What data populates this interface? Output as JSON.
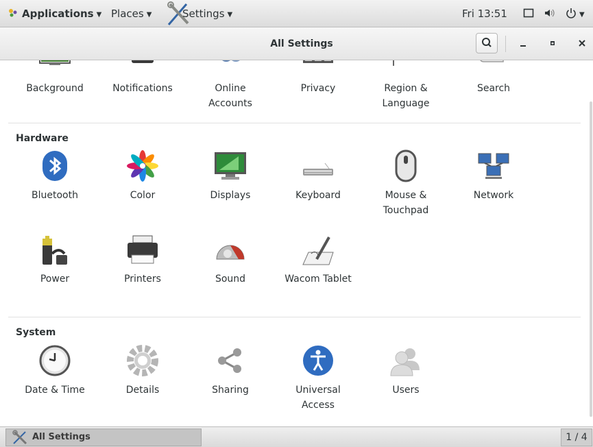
{
  "top_panel": {
    "applications": "Applications",
    "places": "Places",
    "settings": "Settings",
    "clock": "Fri 13:51"
  },
  "window": {
    "title": "All Settings",
    "search_icon": "search-icon",
    "minimize_icon": "minimize-icon",
    "maximize_icon": "maximize-icon",
    "close_icon": "close-icon"
  },
  "personal": {
    "items": [
      {
        "label": "Background",
        "icon": "background-icon"
      },
      {
        "label": "Notifications",
        "icon": "notifications-icon"
      },
      {
        "label": "Online\nAccounts",
        "icon": "online-accounts-icon"
      },
      {
        "label": "Privacy",
        "icon": "privacy-icon"
      },
      {
        "label": "Region &\nLanguage",
        "icon": "region-icon"
      },
      {
        "label": "Search",
        "icon": "search-settings-icon"
      }
    ]
  },
  "hardware": {
    "title": "Hardware",
    "items": [
      {
        "label": "Bluetooth",
        "icon": "bluetooth-icon"
      },
      {
        "label": "Color",
        "icon": "color-icon"
      },
      {
        "label": "Displays",
        "icon": "displays-icon"
      },
      {
        "label": "Keyboard",
        "icon": "keyboard-icon"
      },
      {
        "label": "Mouse &\nTouchpad",
        "icon": "mouse-icon"
      },
      {
        "label": "Network",
        "icon": "network-icon"
      },
      {
        "label": "Power",
        "icon": "power-icon"
      },
      {
        "label": "Printers",
        "icon": "printer-icon"
      },
      {
        "label": "Sound",
        "icon": "sound-icon"
      },
      {
        "label": "Wacom Tablet",
        "icon": "tablet-icon"
      }
    ]
  },
  "system": {
    "title": "System",
    "items": [
      {
        "label": "Date & Time",
        "icon": "clock-icon"
      },
      {
        "label": "Details",
        "icon": "gear-icon"
      },
      {
        "label": "Sharing",
        "icon": "share-icon"
      },
      {
        "label": "Universal\nAccess",
        "icon": "accessibility-icon"
      },
      {
        "label": "Users",
        "icon": "users-icon"
      }
    ]
  },
  "bottom_panel": {
    "task_label": "All Settings",
    "workspace": "1 / 4"
  }
}
